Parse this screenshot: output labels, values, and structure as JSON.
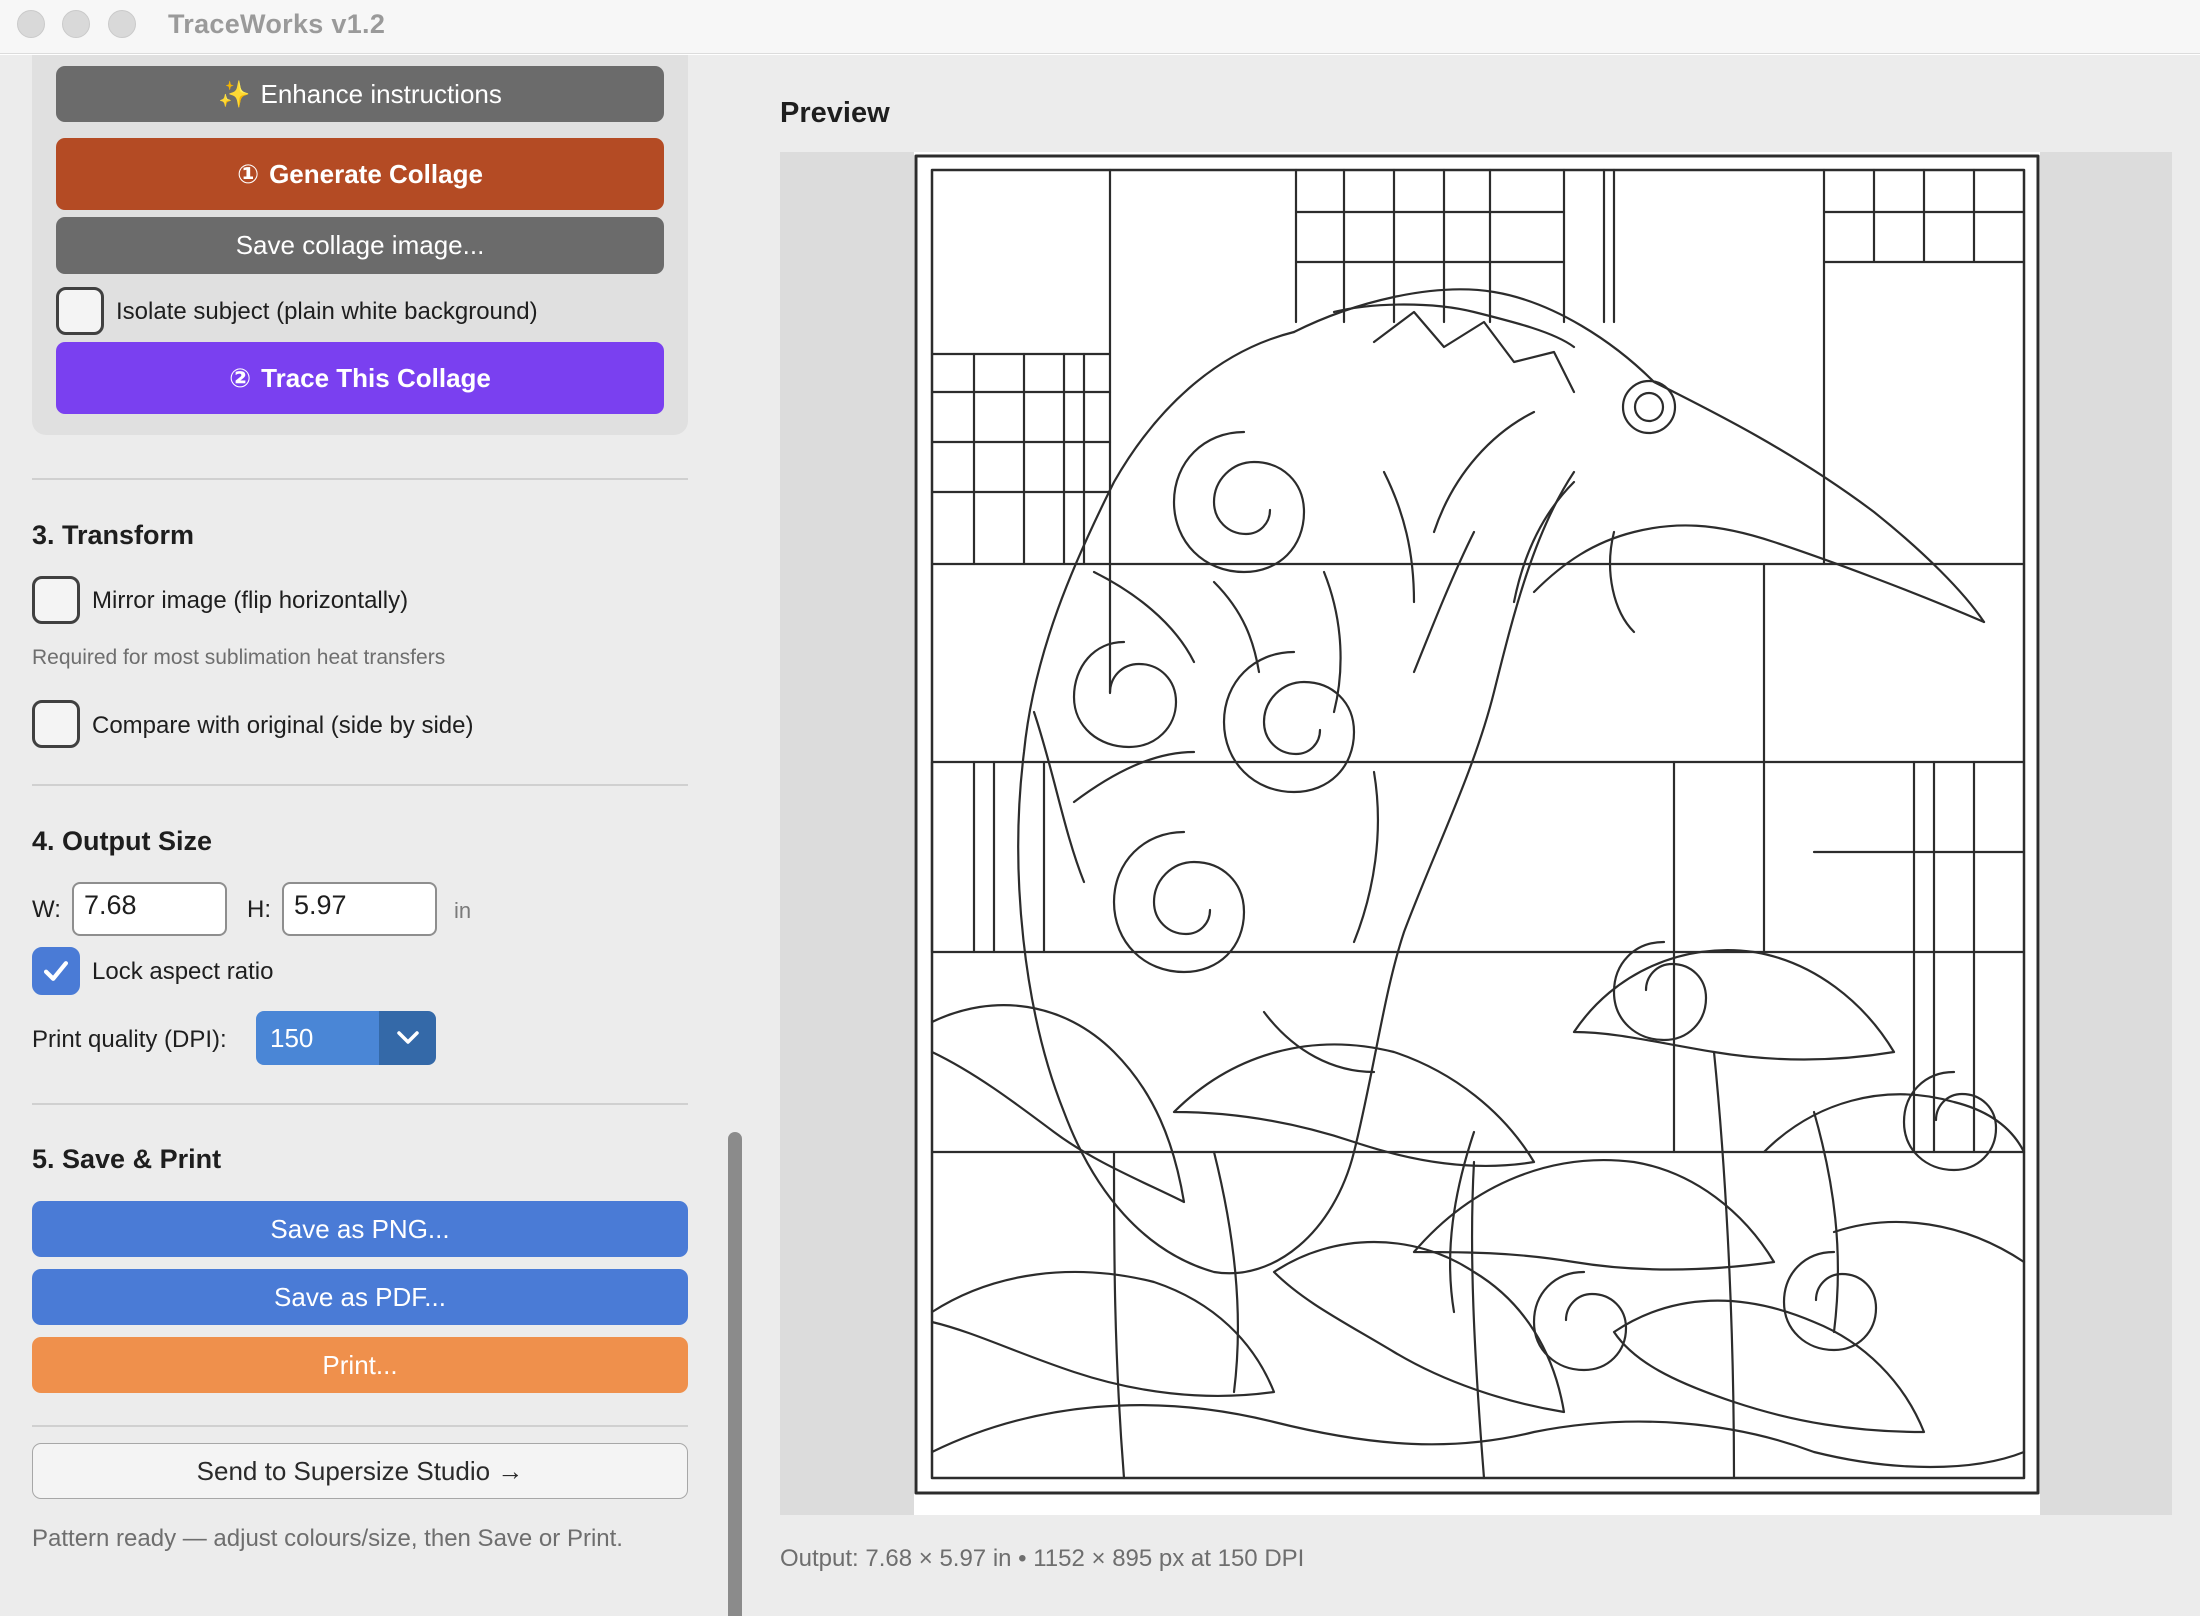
{
  "window": {
    "title": "TraceWorks v1.2"
  },
  "collage": {
    "enhance_label": "Enhance instructions",
    "enhance_icon": "✨",
    "generate_label": "Generate Collage",
    "generate_icon": "①",
    "save_collage_label": "Save collage image...",
    "isolate_label": "Isolate subject (plain white background)",
    "isolate_checked": false,
    "trace_label": "Trace This Collage",
    "trace_icon": "②"
  },
  "transform": {
    "title": "3.  Transform",
    "mirror_label": "Mirror image  (flip horizontally)",
    "mirror_checked": false,
    "mirror_hint": "Required for most sublimation heat transfers",
    "compare_label": "Compare with original  (side by side)",
    "compare_checked": false
  },
  "output_size": {
    "title": "4.  Output Size",
    "w_label": "W:",
    "w_value": "7.68",
    "h_label": "H:",
    "h_value": "5.97",
    "unit": "in",
    "lock_label": "Lock aspect ratio",
    "lock_checked": true,
    "dpi_label": "Print quality (DPI):",
    "dpi_value": "150"
  },
  "save_print": {
    "title": "5.  Save & Print",
    "png_label": "Save as PNG...",
    "pdf_label": "Save as PDF...",
    "print_label": "Print...",
    "supersize_label": "Send to Supersize Studio →",
    "status": "Pattern ready — adjust colours/size, then Save or Print."
  },
  "preview": {
    "title": "Preview",
    "output_info": "Output: 7.68 × 5.97 in   •   1152 × 895 px at 150 DPI"
  },
  "colors": {
    "generate": "#b44b24",
    "trace": "#7a40f0",
    "save": "#4a7bd6",
    "print": "#ef904c"
  }
}
